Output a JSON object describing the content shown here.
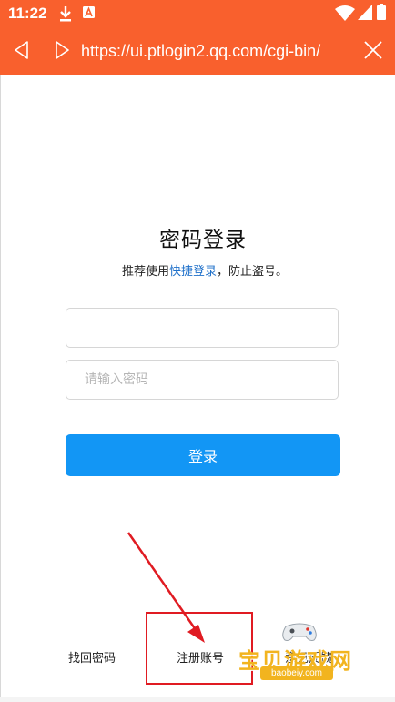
{
  "status_bar": {
    "time": "11:22",
    "icons": [
      "download-icon",
      "app-notification-icon",
      "wifi-icon",
      "signal-icon",
      "battery-icon"
    ]
  },
  "browser": {
    "url": "https://ui.ptlogin2.qq.com/cgi-bin/",
    "back_icon": "back-arrow-icon",
    "forward_icon": "forward-arrow-icon",
    "close_icon": "close-icon",
    "bar_color": "#f9602d"
  },
  "login": {
    "title": "密码登录",
    "subtitle_before": "推荐使用",
    "subtitle_link": "快捷登录",
    "subtitle_after": "，防止盗号。",
    "account_value": "",
    "password_placeholder": "请输入密码",
    "submit_label": "登录",
    "button_color": "#1296f5",
    "link_color": "#1d6fc9"
  },
  "footer": {
    "forgot": "找回密码",
    "register": "注册账号",
    "feedback": "意见反馈"
  },
  "annotation": {
    "color": "#e01b22"
  },
  "watermark": {
    "text": "宝贝游戏网",
    "url": "baobeiy.com",
    "color": "#f2b41f"
  }
}
